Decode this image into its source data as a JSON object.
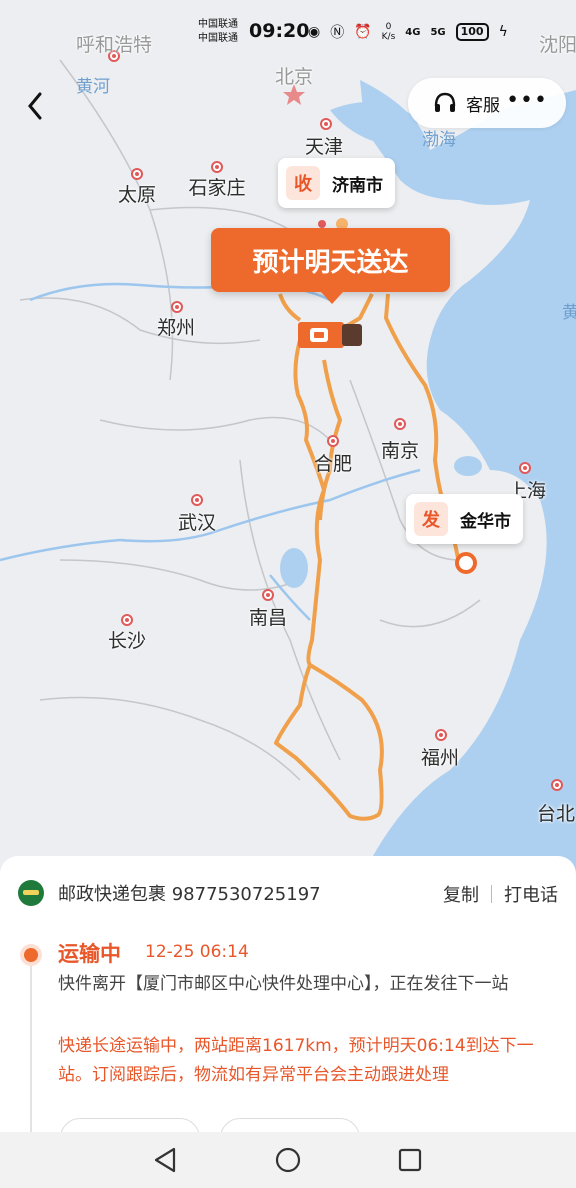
{
  "status_bar": {
    "carrier_1": "中国联通",
    "carrier_2": "中国联通",
    "time": "09:20",
    "speed_value": "0",
    "speed_unit": "K/s",
    "network_1": "4G",
    "network_2": "5G",
    "battery": "100"
  },
  "header": {
    "customer_service_label": "客服",
    "more_label": "•••"
  },
  "map": {
    "cities": [
      {
        "name": "呼和浩特",
        "faded": true
      },
      {
        "name": "北京",
        "faded": true
      },
      {
        "name": "沈阳",
        "faded": true
      },
      {
        "name": "天津"
      },
      {
        "name": "太原"
      },
      {
        "name": "石家庄"
      },
      {
        "name": "郑州"
      },
      {
        "name": "合肥"
      },
      {
        "name": "南京"
      },
      {
        "name": "上海"
      },
      {
        "name": "武汉"
      },
      {
        "name": "南昌"
      },
      {
        "name": "长沙"
      },
      {
        "name": "福州"
      },
      {
        "name": "台北"
      }
    ],
    "sea_labels": [
      "黄河",
      "渤海",
      "黄"
    ],
    "destination": {
      "tag": "收",
      "name": "济南市"
    },
    "origin": {
      "tag": "发",
      "name": "金华市"
    },
    "eta_banner": "预计明天送达",
    "colors": {
      "route": "#f0a04b",
      "accent": "#ee6a2c",
      "sea": "#aed0f0"
    }
  },
  "package": {
    "carrier_tracking": "邮政快递包裹 9877530725197",
    "copy_label": "复制",
    "call_label": "打电话"
  },
  "tracking": {
    "status": "运输中",
    "time": "12-25 06:14",
    "description": "快件离开【厦门市邮区中心快件处理中心】，正在发往下一站",
    "note": "快递长途运输中，两站距离1617km，预计明天06:14到达下一站。订阅跟踪后，物流如有异常平台会主动跟进处理"
  }
}
